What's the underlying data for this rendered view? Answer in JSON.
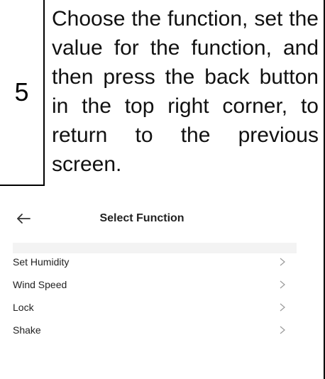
{
  "step": {
    "number": "5",
    "text": "Choose the function, set the value for the function, and then press the back button in the top right corner, to return to the previous screen."
  },
  "screen": {
    "title": "Select Function",
    "back_icon": "back-arrow-icon",
    "functions": [
      {
        "label": "Set Humidity",
        "icon": "chevron-right-icon"
      },
      {
        "label": "Wind Speed",
        "icon": "chevron-right-icon"
      },
      {
        "label": "Lock",
        "icon": "chevron-right-icon"
      },
      {
        "label": "Shake",
        "icon": "chevron-right-icon"
      }
    ]
  }
}
